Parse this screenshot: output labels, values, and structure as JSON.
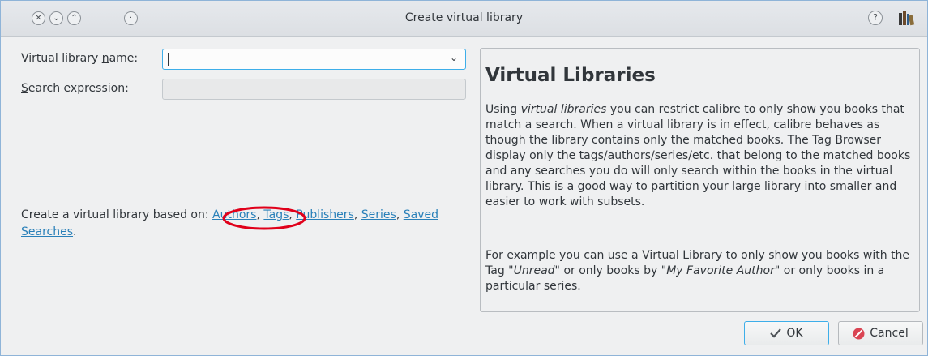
{
  "window": {
    "title": "Create virtual library",
    "controls": [
      "close-icon",
      "minimize-icon",
      "maximize-icon",
      "keep-above-icon"
    ],
    "help_glyph": "?",
    "app_icon": "calibre-books-icon"
  },
  "form": {
    "name_label_pre": "Virtual library ",
    "name_label_u": "n",
    "name_label_post": "ame:",
    "name_value": "",
    "search_label_u": "S",
    "search_label_post": "earch expression:",
    "search_value": ""
  },
  "create": {
    "prefix": "Create a virtual library based on: ",
    "links": [
      "Authors",
      "Tags",
      "Publishers",
      "Series",
      "Saved Searches"
    ],
    "separator": ", ",
    "suffix": ".",
    "highlight_color": "#e0001a"
  },
  "help": {
    "heading": "Virtual Libraries",
    "p1_a": "Using ",
    "p1_em": "virtual libraries",
    "p1_b": " you can restrict calibre to only show you books that match a search. When a virtual library is in effect, calibre behaves as though the library contains only the matched books. The Tag Browser display only the tags/authors/series/etc. that belong to the matched books and any searches you do will only search within the books in the virtual library. This is a good way to partition your large library into smaller and easier to work with subsets.",
    "p2_a": "For example you can use a Virtual Library to only show you books with the Tag ",
    "p2_em1": "\"Unread\"",
    "p2_b": " or only books by ",
    "p2_em2": "\"My Favorite Author\"",
    "p2_c": " or only books in a particular series."
  },
  "buttons": {
    "ok": "OK",
    "cancel": "Cancel"
  },
  "colors": {
    "accent": "#3daee9",
    "link": "#2980b9",
    "cancel_icon": "#da4453"
  }
}
